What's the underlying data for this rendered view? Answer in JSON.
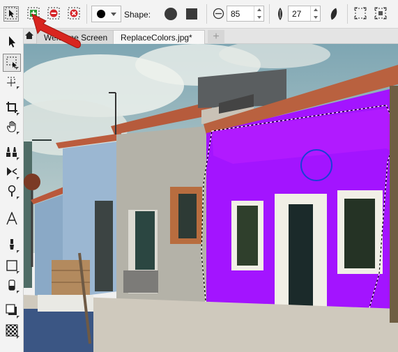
{
  "property_bar": {
    "selection_modes": [
      {
        "name": "normal-mode",
        "icon": "pointer-selection-icon",
        "active": true
      },
      {
        "name": "additive-mode",
        "icon": "add-selection-icon",
        "active": false
      },
      {
        "name": "subtractive-mode",
        "icon": "subtract-selection-icon",
        "active": false
      },
      {
        "name": "xor-mode",
        "icon": "xor-selection-icon",
        "active": false
      }
    ],
    "color_dropdown": {
      "icon": "black-circle-swatch-icon"
    },
    "shape_label": "Shape:",
    "shape_options": [
      "round-nib-icon",
      "square-nib-icon"
    ],
    "size_value": "85",
    "angle_value": "27",
    "mask_buttons": [
      "mask-marquee-icon",
      "invert-mask-icon"
    ]
  },
  "tabs": {
    "home_icon": "home-icon",
    "items": [
      {
        "label": "Welcome Screen",
        "active": false
      },
      {
        "label": "ReplaceColors.jpg*",
        "active": true
      }
    ],
    "add_icon": "plus-icon"
  },
  "toolbox": [
    "pick-tool-icon",
    "rectangle-mask-tool-icon",
    "freehand-mask-tool-icon",
    "crop-tool-icon",
    "pan-hand-tool-icon",
    "clone-tool-icon",
    "brush-tool-icon",
    "eyedropper-tool-icon",
    "text-tool-icon",
    "paint-tool-icon",
    "rectangle-shape-tool-icon",
    "eraser-tool-icon",
    "drop-shadow-tool-icon",
    "transparency-tool-icon"
  ],
  "colors": {
    "accent_magenta": "#a314ff",
    "annotation_arrow": "#d8251f"
  }
}
